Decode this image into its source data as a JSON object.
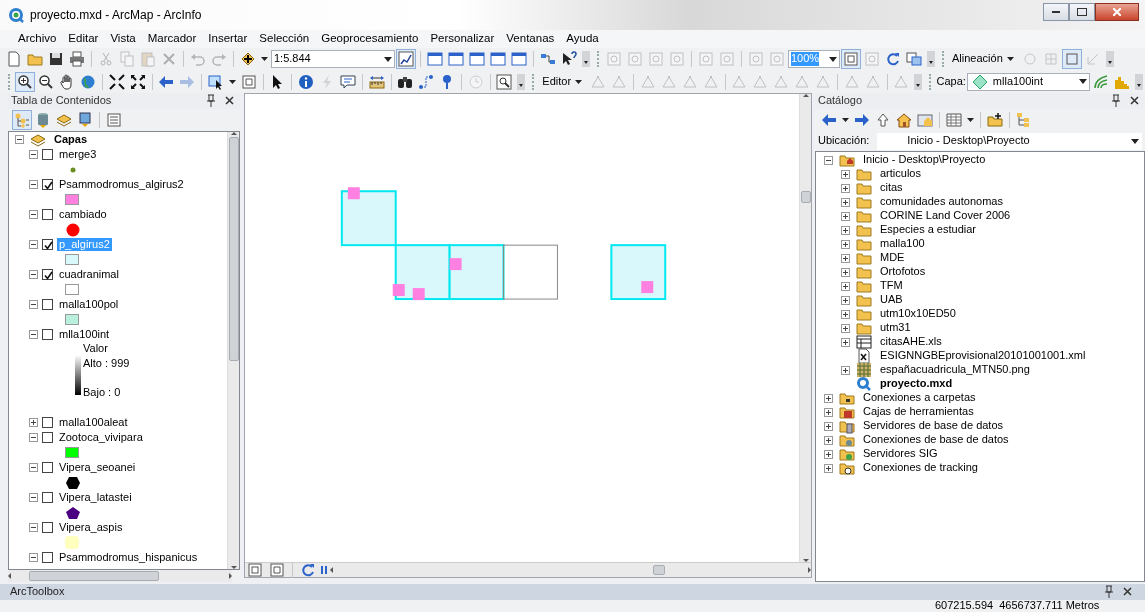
{
  "window": {
    "title": "proyecto.mxd - ArcMap - ArcInfo"
  },
  "menu": [
    "Archivo",
    "Editar",
    "Vista",
    "Marcador",
    "Insertar",
    "Selección",
    "Geoprocesamiento",
    "Personalizar",
    "Ventanas",
    "Ayuda"
  ],
  "toolbars": [
    {
      "items": [
        {
          "kind": "page",
          "disabled": false,
          "pressed": false
        },
        {
          "kind": "folder",
          "disabled": false,
          "pressed": false
        },
        {
          "kind": "save",
          "disabled": false,
          "pressed": false
        },
        {
          "kind": "print",
          "disabled": false,
          "pressed": false
        },
        {
          "kind": "sep"
        },
        {
          "kind": "cut",
          "disabled": true,
          "pressed": false
        },
        {
          "kind": "copy",
          "disabled": true,
          "pressed": false
        },
        {
          "kind": "paste",
          "disabled": true,
          "pressed": false
        },
        {
          "kind": "delete",
          "disabled": true,
          "pressed": false
        },
        {
          "kind": "sep"
        },
        {
          "kind": "undo",
          "disabled": true,
          "pressed": false
        },
        {
          "kind": "redo",
          "disabled": true,
          "pressed": false
        },
        {
          "kind": "sep"
        },
        {
          "kind": "add",
          "disabled": false,
          "pressed": false
        },
        {
          "kind": "caret"
        },
        {
          "kind": "scalebox",
          "value": "1:5.844",
          "highlighted": false
        },
        {
          "kind": "sketch",
          "disabled": false,
          "pressed": true
        },
        {
          "kind": "sep"
        },
        {
          "kind": "window",
          "disabled": false,
          "pressed": false
        },
        {
          "kind": "window",
          "disabled": false,
          "pressed": false
        },
        {
          "kind": "window",
          "disabled": false,
          "pressed": false
        },
        {
          "kind": "window",
          "disabled": false,
          "pressed": false
        },
        {
          "kind": "window",
          "disabled": false,
          "pressed": false
        },
        {
          "kind": "sep"
        },
        {
          "kind": "connector",
          "disabled": false,
          "pressed": false
        },
        {
          "kind": "help",
          "disabled": false,
          "pressed": false
        },
        {
          "kind": "overflow"
        },
        {
          "kind": "grip"
        },
        {
          "kind": "pagezoom",
          "disabled": true,
          "pressed": false
        },
        {
          "kind": "pagezoom",
          "disabled": true,
          "pressed": false
        },
        {
          "kind": "pagezoom",
          "disabled": true,
          "pressed": false
        },
        {
          "kind": "pagezoom",
          "disabled": true,
          "pressed": false
        },
        {
          "kind": "sep"
        },
        {
          "kind": "pagezoom",
          "disabled": true,
          "pressed": false
        },
        {
          "kind": "pagezoom",
          "disabled": true,
          "pressed": false
        },
        {
          "kind": "sep"
        },
        {
          "kind": "pagezoom",
          "disabled": true,
          "pressed": false
        },
        {
          "kind": "pagezoom",
          "disabled": true,
          "pressed": false
        },
        {
          "kind": "zoombox",
          "value": "100%",
          "highlighted": true
        },
        {
          "kind": "layoutpage",
          "disabled": false,
          "pressed": true
        },
        {
          "kind": "pagezoom",
          "disabled": true,
          "pressed": false
        },
        {
          "kind": "refresh",
          "disabled": false,
          "pressed": false
        },
        {
          "kind": "swap",
          "disabled": false,
          "pressed": false
        },
        {
          "kind": "overflow"
        },
        {
          "kind": "grip"
        },
        {
          "kind": "menu",
          "label": "Alineación"
        },
        {
          "kind": "circle",
          "disabled": true,
          "pressed": false
        },
        {
          "kind": "grid",
          "disabled": true,
          "pressed": false
        },
        {
          "kind": "square",
          "disabled": false,
          "pressed": true
        },
        {
          "kind": "corner",
          "disabled": true,
          "pressed": false
        },
        {
          "kind": "overflow"
        }
      ]
    },
    {
      "items": [
        {
          "kind": "grip"
        },
        {
          "kind": "zoomin",
          "disabled": false,
          "pressed": true
        },
        {
          "kind": "zoomout",
          "disabled": false,
          "pressed": false
        },
        {
          "kind": "pan",
          "disabled": false,
          "pressed": false
        },
        {
          "kind": "globe",
          "disabled": false,
          "pressed": false
        },
        {
          "kind": "sep"
        },
        {
          "kind": "shrink",
          "disabled": false,
          "pressed": false
        },
        {
          "kind": "expand",
          "disabled": false,
          "pressed": false
        },
        {
          "kind": "sep"
        },
        {
          "kind": "back",
          "disabled": false,
          "pressed": false
        },
        {
          "kind": "forward",
          "disabled": true,
          "pressed": false
        },
        {
          "kind": "sep"
        },
        {
          "kind": "select",
          "disabled": false,
          "pressed": false
        },
        {
          "kind": "caret"
        },
        {
          "kind": "clearsel",
          "disabled": false,
          "pressed": false
        },
        {
          "kind": "sep"
        },
        {
          "kind": "pointer",
          "disabled": false,
          "pressed": false
        },
        {
          "kind": "sep"
        },
        {
          "kind": "info",
          "disabled": false,
          "pressed": false
        },
        {
          "kind": "lightning",
          "disabled": true,
          "pressed": false
        },
        {
          "kind": "popup",
          "disabled": false,
          "pressed": false
        },
        {
          "kind": "sep"
        },
        {
          "kind": "measure",
          "disabled": false,
          "pressed": false
        },
        {
          "kind": "sep"
        },
        {
          "kind": "find",
          "disabled": false,
          "pressed": false
        },
        {
          "kind": "route",
          "disabled": false,
          "pressed": false
        },
        {
          "kind": "xy",
          "disabled": false,
          "pressed": false
        },
        {
          "kind": "sep"
        },
        {
          "kind": "clock",
          "disabled": true,
          "pressed": false
        },
        {
          "kind": "sep"
        },
        {
          "kind": "magnify",
          "disabled": false,
          "pressed": false
        },
        {
          "kind": "overflow"
        },
        {
          "kind": "grip"
        },
        {
          "kind": "menu",
          "label": "Editor"
        },
        {
          "kind": "edittool",
          "disabled": true,
          "pressed": false
        },
        {
          "kind": "edittool",
          "disabled": true,
          "pressed": false
        },
        {
          "kind": "sep"
        },
        {
          "kind": "edittool",
          "disabled": true,
          "pressed": false
        },
        {
          "kind": "edittool",
          "disabled": true,
          "pressed": false
        },
        {
          "kind": "edittool",
          "disabled": true,
          "pressed": false
        },
        {
          "kind": "edittool",
          "disabled": true,
          "pressed": false
        },
        {
          "kind": "sep"
        },
        {
          "kind": "edittool",
          "disabled": true,
          "pressed": false
        },
        {
          "kind": "edittool",
          "disabled": true,
          "pressed": false
        },
        {
          "kind": "edittool",
          "disabled": true,
          "pressed": false
        },
        {
          "kind": "edittool",
          "disabled": true,
          "pressed": false
        },
        {
          "kind": "edittool",
          "disabled": true,
          "pressed": false
        },
        {
          "kind": "sep"
        },
        {
          "kind": "edittool",
          "disabled": true,
          "pressed": false
        },
        {
          "kind": "edittool",
          "disabled": true,
          "pressed": false
        },
        {
          "kind": "sep"
        },
        {
          "kind": "edittool",
          "disabled": true,
          "pressed": false
        },
        {
          "kind": "overflow"
        },
        {
          "kind": "grip"
        },
        {
          "kind": "label",
          "text": "Capa:"
        },
        {
          "kind": "layerbox",
          "value": "mlla100int",
          "highlighted": false
        },
        {
          "kind": "contour",
          "disabled": false,
          "pressed": false
        },
        {
          "kind": "histogram",
          "disabled": false,
          "pressed": false
        },
        {
          "kind": "overflow"
        }
      ]
    }
  ],
  "toc": {
    "title": "Tabla de Contenidos",
    "views": [
      {
        "kind": "drawing",
        "selected": true
      },
      {
        "kind": "source",
        "selected": false
      },
      {
        "kind": "visibility",
        "selected": false
      },
      {
        "kind": "selection",
        "selected": false
      },
      {
        "kind": "options",
        "selected": false
      }
    ],
    "root": {
      "label": "Capas",
      "expanded": true,
      "children": [
        {
          "label": "merge3",
          "checked": false,
          "expanded": true,
          "selected": false,
          "symbol": {
            "kind": "point",
            "color": "#6b8e23"
          }
        },
        {
          "label": "Psammodromus_algirus2",
          "checked": true,
          "expanded": true,
          "selected": false,
          "symbol": {
            "kind": "square",
            "color": "#ff80e0"
          }
        },
        {
          "label": "cambiado",
          "checked": false,
          "expanded": true,
          "selected": false,
          "symbol": {
            "kind": "circle",
            "color": "#ff0000"
          }
        },
        {
          "label": "p_algirus2",
          "checked": true,
          "expanded": true,
          "selected": true,
          "symbol": {
            "kind": "square",
            "color": "#d8f8fc"
          }
        },
        {
          "label": "cuadranimal",
          "checked": true,
          "expanded": true,
          "selected": false,
          "symbol": {
            "kind": "square",
            "color": "#ffffff"
          }
        },
        {
          "label": "malla100pol",
          "checked": false,
          "expanded": true,
          "selected": false,
          "symbol": {
            "kind": "square",
            "color": "#b8f0dc"
          }
        },
        {
          "label": "mlla100int",
          "checked": false,
          "expanded": true,
          "selected": false,
          "symbol": {
            "kind": "ramp",
            "title": "Valor",
            "high": "Alto : 999",
            "low": "Bajo : 0"
          }
        },
        {
          "label": "malla100aleat",
          "checked": false,
          "expanded": false,
          "selected": false
        },
        {
          "label": "Zootoca_vivipara",
          "checked": false,
          "expanded": true,
          "selected": false,
          "symbol": {
            "kind": "square",
            "color": "#00ff00"
          }
        },
        {
          "label": "Vipera_seoanei",
          "checked": false,
          "expanded": true,
          "selected": false,
          "symbol": {
            "kind": "hexagon",
            "color": "#000000"
          }
        },
        {
          "label": "Vipera_latastei",
          "checked": false,
          "expanded": true,
          "selected": false,
          "symbol": {
            "kind": "pentagon",
            "color": "#4b0082"
          }
        },
        {
          "label": "Vipera_aspis",
          "checked": false,
          "expanded": true,
          "selected": false,
          "symbol": {
            "kind": "rounded",
            "color": "#ffffc0"
          }
        },
        {
          "label": "Psammodromus_hispanicus",
          "checked": false,
          "expanded": true,
          "selected": false
        }
      ]
    }
  },
  "catalog": {
    "title": "Catálogo",
    "toolbar": [
      {
        "kind": "back"
      },
      {
        "kind": "caret"
      },
      {
        "kind": "forward"
      },
      {
        "kind": "up"
      },
      {
        "kind": "home"
      },
      {
        "kind": "homelink"
      },
      {
        "kind": "sep"
      },
      {
        "kind": "viewgrid"
      },
      {
        "kind": "caret"
      },
      {
        "kind": "sep"
      },
      {
        "kind": "connect"
      },
      {
        "kind": "sep"
      },
      {
        "kind": "treetoggle"
      }
    ],
    "location_label": "Ubicación:",
    "location": "Inicio - Desktop\\Proyecto",
    "tree": [
      {
        "label": "Inicio - Desktop\\Proyecto",
        "kind": "homefolder",
        "expanded": true,
        "children": [
          {
            "label": "articulos",
            "kind": "folder",
            "expanded": false
          },
          {
            "label": "citas",
            "kind": "folder",
            "expanded": false
          },
          {
            "label": "comunidades autonomas",
            "kind": "folder",
            "expanded": false
          },
          {
            "label": "CORINE Land Cover 2006",
            "kind": "folder",
            "expanded": false
          },
          {
            "label": "Especies a estudiar",
            "kind": "folder",
            "expanded": false
          },
          {
            "label": "malla100",
            "kind": "folder",
            "expanded": false
          },
          {
            "label": "MDE",
            "kind": "folder",
            "expanded": false
          },
          {
            "label": "Ortofotos",
            "kind": "folder",
            "expanded": false
          },
          {
            "label": "TFM",
            "kind": "folder",
            "expanded": false
          },
          {
            "label": "UAB",
            "kind": "folder",
            "expanded": false
          },
          {
            "label": "utm10x10ED50",
            "kind": "folder",
            "expanded": false
          },
          {
            "label": "utm31",
            "kind": "folder",
            "expanded": false
          },
          {
            "label": "citasAHE.xls",
            "kind": "sheet",
            "expanded": false
          },
          {
            "label": "ESIGNNGBEprovisional20101001001.xml",
            "kind": "xml"
          },
          {
            "label": "españacuadricula_MTN50.png",
            "kind": "raster",
            "expanded": false
          },
          {
            "label": "proyecto.mxd",
            "kind": "mxd"
          }
        ]
      },
      {
        "label": "Conexiones a carpetas",
        "kind": "folderconn",
        "expanded": false
      },
      {
        "label": "Cajas de herramientas",
        "kind": "toolbox",
        "expanded": false
      },
      {
        "label": "Servidores de base de datos",
        "kind": "dbserver",
        "expanded": false
      },
      {
        "label": "Conexiones de base de datos",
        "kind": "dbconn",
        "expanded": false
      },
      {
        "label": "Servidores SIG",
        "kind": "gisserver",
        "expanded": false
      },
      {
        "label": "Conexiones de tracking",
        "kind": "tracking",
        "expanded": false
      }
    ]
  },
  "toolbox": {
    "title": "ArcToolbox"
  },
  "status_bar": {
    "coordinates": "607215.594  4656737.711 Metros"
  }
}
